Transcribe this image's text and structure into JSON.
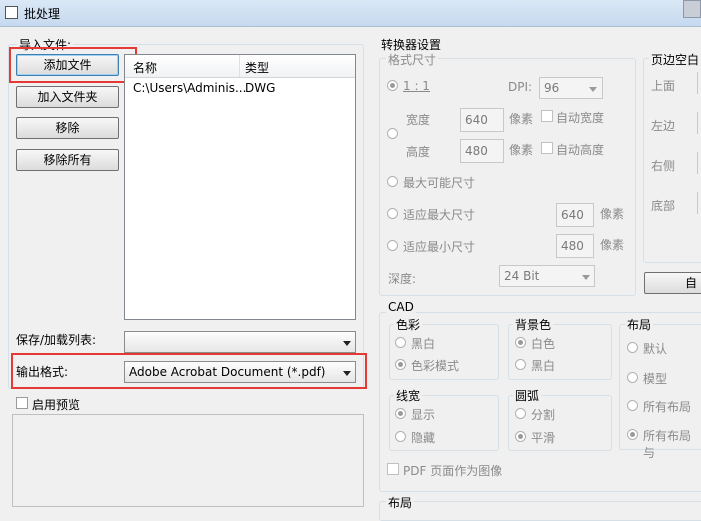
{
  "window": {
    "title": "批处理"
  },
  "import": {
    "group_label": "导入文件:",
    "buttons": {
      "add_file": "添加文件",
      "add_folder": "加入文件夹",
      "remove": "移除",
      "remove_all": "移除所有"
    },
    "table": {
      "columns": [
        "名称",
        "类型"
      ],
      "rows": [
        {
          "name": "C:\\Users\\Adminis...",
          "type": "DWG"
        }
      ]
    },
    "save_load_label": "保存/加载列表:",
    "save_load_value": "",
    "output_format_label": "输出格式:",
    "output_format_value": "Adobe Acrobat Document (*.pdf)",
    "enable_preview_label": "启用预览"
  },
  "converter": {
    "group_label": "转换器设置",
    "format_size": {
      "label": "格式尺寸",
      "ratio_label": "1 : 1",
      "dpi_label": "DPI:",
      "dpi_value": "96",
      "width_label": "宽度",
      "width_value": "640",
      "height_label": "高度",
      "height_value": "480",
      "pixel_unit": "像素",
      "auto_width": "自动宽度",
      "auto_height": "自动高度",
      "max_possible": "最大可能尺寸",
      "fit_max": "适应最大尺寸",
      "fit_max_value": "640",
      "fit_min": "适应最小尺寸",
      "fit_min_value": "480",
      "depth_label": "深度:",
      "depth_value": "24 Bit"
    },
    "page_margin": {
      "label": "页边空白",
      "top": "上面",
      "left": "左边",
      "right": "右侧",
      "bottom": "底部",
      "auto_button": "自"
    },
    "cad": {
      "label": "CAD",
      "color": {
        "label": "色彩",
        "mono": "黑白",
        "color_mode": "色彩模式"
      },
      "background": {
        "label": "背景色",
        "white": "白色",
        "black": "黑白"
      },
      "layout": {
        "label": "布局",
        "default": "默认",
        "model": "模型",
        "all_layouts": "所有布局",
        "all_layouts_plus": "所有布局与"
      },
      "lineweight": {
        "label": "线宽",
        "show": "显示",
        "hide": "隐藏"
      },
      "arc": {
        "label": "圆弧",
        "split": "分割",
        "smooth": "平滑"
      },
      "pdf_as_image": "PDF 页面作为图像"
    },
    "layout_bottom_label": "布局"
  },
  "colors": {
    "highlight_border": "#e53935",
    "titlebar": "#c5d9ef"
  }
}
